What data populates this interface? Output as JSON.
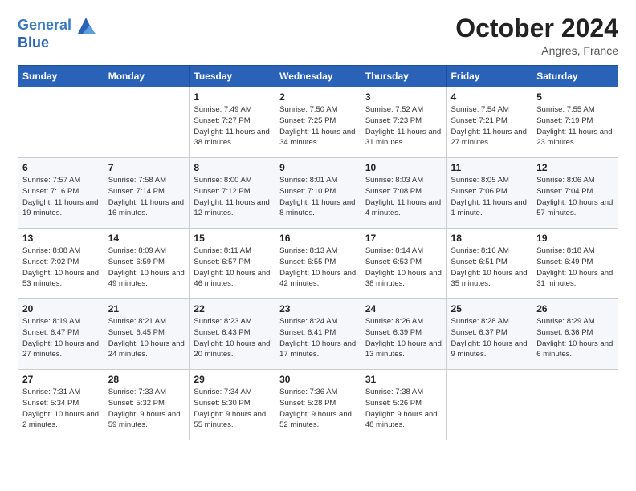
{
  "header": {
    "logo_line1": "General",
    "logo_line2": "Blue",
    "month": "October 2024",
    "location": "Angres, France"
  },
  "weekdays": [
    "Sunday",
    "Monday",
    "Tuesday",
    "Wednesday",
    "Thursday",
    "Friday",
    "Saturday"
  ],
  "weeks": [
    [
      {
        "day": "",
        "info": ""
      },
      {
        "day": "",
        "info": ""
      },
      {
        "day": "1",
        "info": "Sunrise: 7:49 AM\nSunset: 7:27 PM\nDaylight: 11 hours and 38 minutes."
      },
      {
        "day": "2",
        "info": "Sunrise: 7:50 AM\nSunset: 7:25 PM\nDaylight: 11 hours and 34 minutes."
      },
      {
        "day": "3",
        "info": "Sunrise: 7:52 AM\nSunset: 7:23 PM\nDaylight: 11 hours and 31 minutes."
      },
      {
        "day": "4",
        "info": "Sunrise: 7:54 AM\nSunset: 7:21 PM\nDaylight: 11 hours and 27 minutes."
      },
      {
        "day": "5",
        "info": "Sunrise: 7:55 AM\nSunset: 7:19 PM\nDaylight: 11 hours and 23 minutes."
      }
    ],
    [
      {
        "day": "6",
        "info": "Sunrise: 7:57 AM\nSunset: 7:16 PM\nDaylight: 11 hours and 19 minutes."
      },
      {
        "day": "7",
        "info": "Sunrise: 7:58 AM\nSunset: 7:14 PM\nDaylight: 11 hours and 16 minutes."
      },
      {
        "day": "8",
        "info": "Sunrise: 8:00 AM\nSunset: 7:12 PM\nDaylight: 11 hours and 12 minutes."
      },
      {
        "day": "9",
        "info": "Sunrise: 8:01 AM\nSunset: 7:10 PM\nDaylight: 11 hours and 8 minutes."
      },
      {
        "day": "10",
        "info": "Sunrise: 8:03 AM\nSunset: 7:08 PM\nDaylight: 11 hours and 4 minutes."
      },
      {
        "day": "11",
        "info": "Sunrise: 8:05 AM\nSunset: 7:06 PM\nDaylight: 11 hours and 1 minute."
      },
      {
        "day": "12",
        "info": "Sunrise: 8:06 AM\nSunset: 7:04 PM\nDaylight: 10 hours and 57 minutes."
      }
    ],
    [
      {
        "day": "13",
        "info": "Sunrise: 8:08 AM\nSunset: 7:02 PM\nDaylight: 10 hours and 53 minutes."
      },
      {
        "day": "14",
        "info": "Sunrise: 8:09 AM\nSunset: 6:59 PM\nDaylight: 10 hours and 49 minutes."
      },
      {
        "day": "15",
        "info": "Sunrise: 8:11 AM\nSunset: 6:57 PM\nDaylight: 10 hours and 46 minutes."
      },
      {
        "day": "16",
        "info": "Sunrise: 8:13 AM\nSunset: 6:55 PM\nDaylight: 10 hours and 42 minutes."
      },
      {
        "day": "17",
        "info": "Sunrise: 8:14 AM\nSunset: 6:53 PM\nDaylight: 10 hours and 38 minutes."
      },
      {
        "day": "18",
        "info": "Sunrise: 8:16 AM\nSunset: 6:51 PM\nDaylight: 10 hours and 35 minutes."
      },
      {
        "day": "19",
        "info": "Sunrise: 8:18 AM\nSunset: 6:49 PM\nDaylight: 10 hours and 31 minutes."
      }
    ],
    [
      {
        "day": "20",
        "info": "Sunrise: 8:19 AM\nSunset: 6:47 PM\nDaylight: 10 hours and 27 minutes."
      },
      {
        "day": "21",
        "info": "Sunrise: 8:21 AM\nSunset: 6:45 PM\nDaylight: 10 hours and 24 minutes."
      },
      {
        "day": "22",
        "info": "Sunrise: 8:23 AM\nSunset: 6:43 PM\nDaylight: 10 hours and 20 minutes."
      },
      {
        "day": "23",
        "info": "Sunrise: 8:24 AM\nSunset: 6:41 PM\nDaylight: 10 hours and 17 minutes."
      },
      {
        "day": "24",
        "info": "Sunrise: 8:26 AM\nSunset: 6:39 PM\nDaylight: 10 hours and 13 minutes."
      },
      {
        "day": "25",
        "info": "Sunrise: 8:28 AM\nSunset: 6:37 PM\nDaylight: 10 hours and 9 minutes."
      },
      {
        "day": "26",
        "info": "Sunrise: 8:29 AM\nSunset: 6:36 PM\nDaylight: 10 hours and 6 minutes."
      }
    ],
    [
      {
        "day": "27",
        "info": "Sunrise: 7:31 AM\nSunset: 5:34 PM\nDaylight: 10 hours and 2 minutes."
      },
      {
        "day": "28",
        "info": "Sunrise: 7:33 AM\nSunset: 5:32 PM\nDaylight: 9 hours and 59 minutes."
      },
      {
        "day": "29",
        "info": "Sunrise: 7:34 AM\nSunset: 5:30 PM\nDaylight: 9 hours and 55 minutes."
      },
      {
        "day": "30",
        "info": "Sunrise: 7:36 AM\nSunset: 5:28 PM\nDaylight: 9 hours and 52 minutes."
      },
      {
        "day": "31",
        "info": "Sunrise: 7:38 AM\nSunset: 5:26 PM\nDaylight: 9 hours and 48 minutes."
      },
      {
        "day": "",
        "info": ""
      },
      {
        "day": "",
        "info": ""
      }
    ]
  ]
}
